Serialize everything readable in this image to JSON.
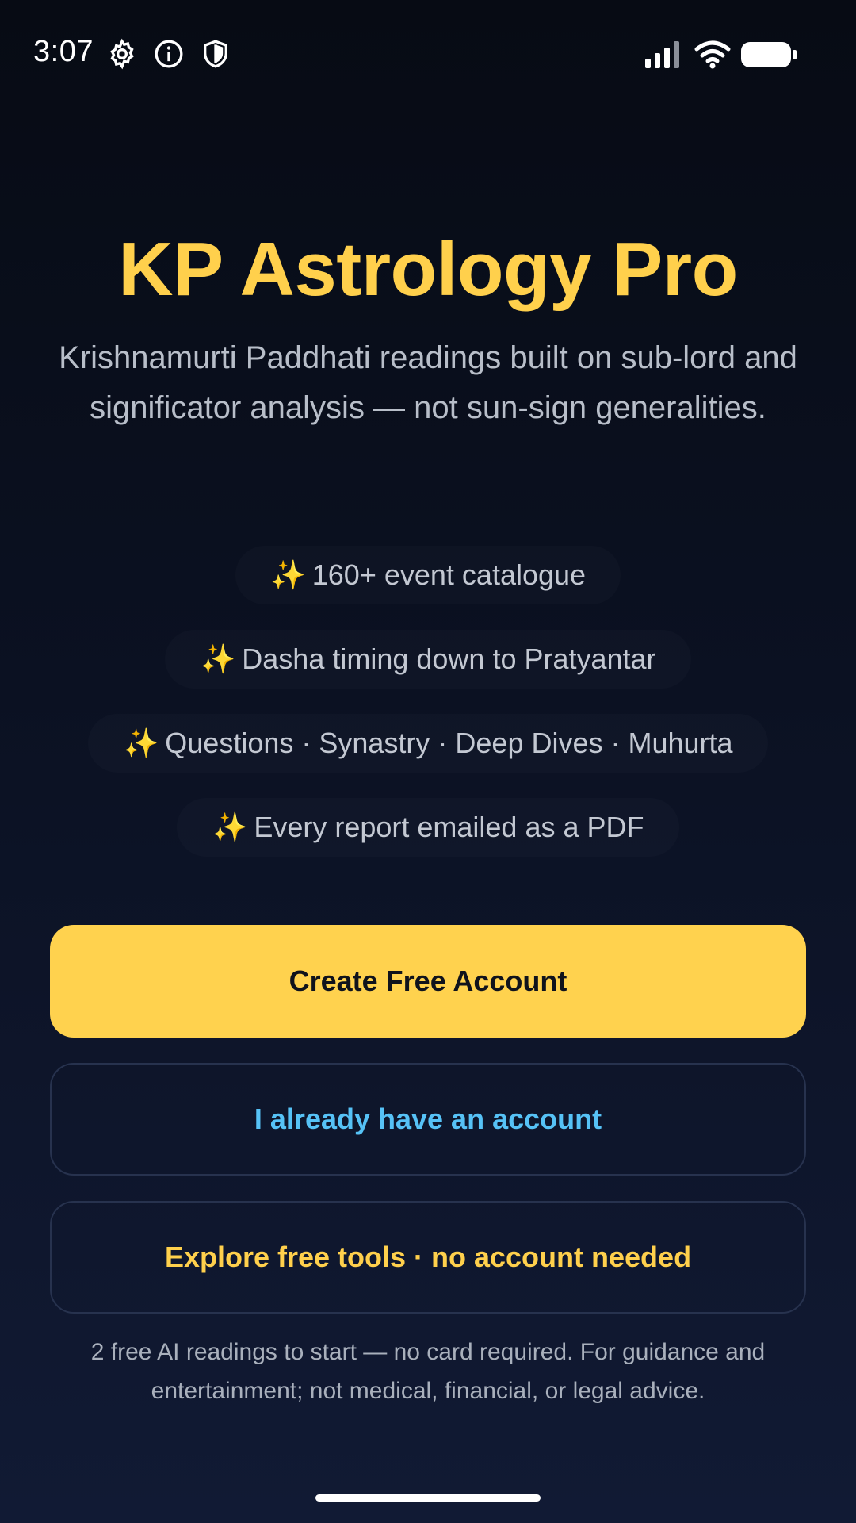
{
  "status_bar": {
    "time": "3:07",
    "icons_left": [
      "gear-icon",
      "info-icon",
      "shield-icon"
    ],
    "icons_right": [
      "signal-icon",
      "wifi-icon",
      "battery-icon"
    ]
  },
  "hero": {
    "title": "KP Astrology Pro",
    "subtitle": "Krishnamurti Paddhati readings built on sub-lord and significator analysis — not sun-sign generalities."
  },
  "features": [
    {
      "icon": "✨",
      "label": "160+ event catalogue"
    },
    {
      "icon": "✨",
      "label": "Dasha timing down to Pratyantar"
    },
    {
      "icon": "✨",
      "label": "Questions · Synastry · Deep Dives · Muhurta"
    },
    {
      "icon": "✨",
      "label": "Every report emailed as a PDF"
    }
  ],
  "actions": {
    "create_account": "Create Free Account",
    "sign_in": "I already have an account",
    "explore": "Explore free tools · no account needed"
  },
  "footnote": "2 free AI readings to start — no card required. For guidance and entertainment; not medical, financial, or legal advice.",
  "colors": {
    "accent_gold": "#ffd04c",
    "accent_blue": "#56c2f6",
    "background_top": "#070b14",
    "background_bottom": "#111a34"
  }
}
